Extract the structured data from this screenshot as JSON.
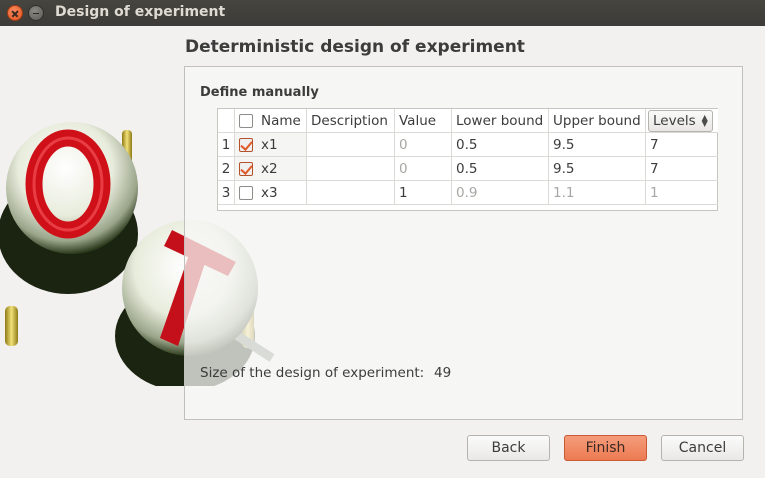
{
  "window": {
    "title": "Design of experiment"
  },
  "page": {
    "title": "Deterministic design of experiment"
  },
  "section": {
    "title": "Define manually"
  },
  "table": {
    "headers": [
      "Name",
      "Description",
      "Value",
      "Lower bound",
      "Upper bound",
      "Levels"
    ],
    "rows": [
      {
        "num": "1",
        "checked": true,
        "name": "x1",
        "description": "",
        "value": "0",
        "lower": "0.5",
        "upper": "9.5",
        "levels": "7"
      },
      {
        "num": "2",
        "checked": true,
        "name": "x2",
        "description": "",
        "value": "0",
        "lower": "0.5",
        "upper": "9.5",
        "levels": "7"
      },
      {
        "num": "3",
        "checked": false,
        "name": "x3",
        "description": "",
        "value": "1",
        "lower": "0.9",
        "upper": "1.1",
        "levels": "1"
      }
    ]
  },
  "summary": {
    "label": "Size of the design of experiment:",
    "value": "49"
  },
  "buttons": {
    "back": "Back",
    "finish": "Finish",
    "cancel": "Cancel"
  },
  "colors": {
    "accent": "#ec7a52",
    "titlebar": "#3c3b37",
    "checkmark": "#e05a2b"
  }
}
